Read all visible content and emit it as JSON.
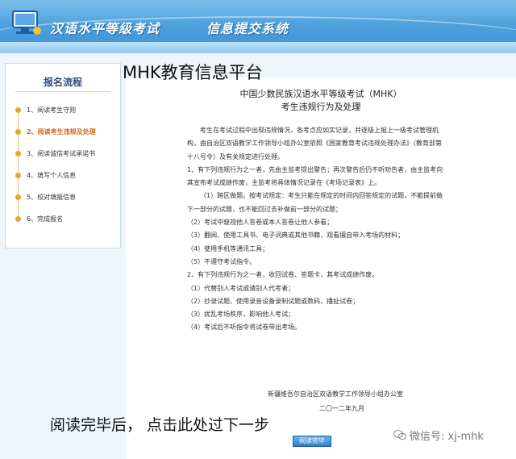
{
  "header": {
    "title_left": "汉语水平等级考试",
    "title_right": "信息提交系统"
  },
  "watermarks": {
    "top": "MHK教育信息平台",
    "bottom": "阅读完毕后， 点击此处过下一步",
    "wechat": "微信号: xj-mhk"
  },
  "sidebar": {
    "title": "报名流程",
    "steps": [
      {
        "label": "1、阅读考生守则",
        "active": false
      },
      {
        "label": "2、阅读考生违规及处理",
        "active": true
      },
      {
        "label": "3、阅读诚信考试承诺书",
        "active": false
      },
      {
        "label": "4、填写个人信息",
        "active": false
      },
      {
        "label": "5、校对填报信息",
        "active": false
      },
      {
        "label": "6、完成报名",
        "active": false
      }
    ]
  },
  "document": {
    "title_line1": "中国少数民族汉语水平等级考试（MHK）",
    "title_line2": "考生违规行为及处理",
    "paragraphs": [
      "考生在考试过程中出现违规情况，各考点应如实记录，并逐级上报上一级考试管理机构，由自治区双语教学工作领导小组办公室依照《国家教育考试违规处理办法》（教育部第十八号令）及有关规定进行处理。",
      "1、有下列违规行为之一者，先由主监考提出警告；再次警告后仍不听劝告者，由主监考向其宣布考试成绩作废，主监考将具体情况记录在《考场记录表》上。",
      "（1）跨区做题。按考试规定：考生只能在规定的时间内回答规定的试题，不能提前做下一部分的试题，也不能回过去补做前一部分的试题；",
      "（2）考试中窥视他人答卷或本人答卷让他人参看；",
      "（3）翻阅、使用工具书、电子词典或其他书籍，观看擅自带入考场的材料；",
      "（4）使用手机等通讯工具；",
      "（5）不遵守考试指令。",
      "2、有下列违规行为之一者，收回试卷、答题卡，其考试成绩作废。",
      "（1）代替别人考试或请别人代考者；",
      "（2）抄录试题、使用录音设备录制试题或数码、播扯试卷；",
      "（3）扰乱考场秩序，影响他人考试；",
      "（4）考试后不听指令将试卷带出考场。"
    ],
    "signature": "新疆维吾尔自治区双语教学工作领导小组办公室",
    "date": "二〇一二年九月"
  },
  "button": {
    "read_done": "阅读完毕"
  },
  "colors": {
    "header_blue": "#4fa2de",
    "active_step": "#d2691e",
    "step_dot": "#e0a82c",
    "button_blue": "#2f7fcb"
  }
}
